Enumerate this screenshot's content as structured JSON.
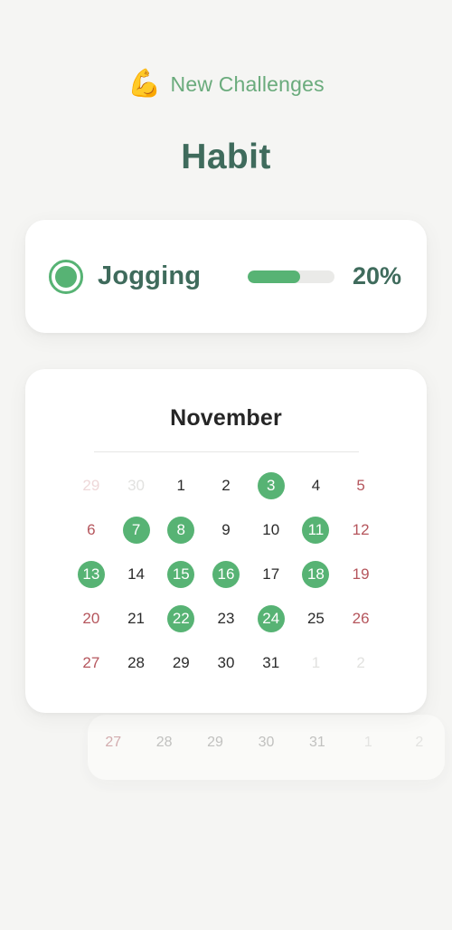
{
  "header": {
    "emoji": "💪",
    "emoji_name": "flexed-biceps-emoji",
    "title": "New Challenges",
    "page_title": "Habit"
  },
  "colors": {
    "background": "#f5f5f3",
    "card": "#ffffff",
    "accent_green": "#57b374",
    "sage_green": "#6aab7c",
    "dark_green": "#3f6b5c",
    "weekend_red": "#b5555c",
    "track_gray": "#eaeae8"
  },
  "habit": {
    "name": "Jogging",
    "percent_label": "20%",
    "percent_value": 20,
    "progress_fill_ratio": 60,
    "status_icon": "radio-selected-icon"
  },
  "calendar": {
    "month": "November",
    "weeks": [
      [
        {
          "label": "29",
          "state": "out-red"
        },
        {
          "label": "30",
          "state": "out-gray"
        },
        {
          "label": "1",
          "state": "normal"
        },
        {
          "label": "2",
          "state": "normal"
        },
        {
          "label": "3",
          "state": "done"
        },
        {
          "label": "4",
          "state": "normal"
        },
        {
          "label": "5",
          "state": "red"
        }
      ],
      [
        {
          "label": "6",
          "state": "red"
        },
        {
          "label": "7",
          "state": "done"
        },
        {
          "label": "8",
          "state": "done"
        },
        {
          "label": "9",
          "state": "normal"
        },
        {
          "label": "10",
          "state": "normal"
        },
        {
          "label": "11",
          "state": "done"
        },
        {
          "label": "12",
          "state": "red"
        }
      ],
      [
        {
          "label": "13",
          "state": "done"
        },
        {
          "label": "14",
          "state": "normal"
        },
        {
          "label": "15",
          "state": "done"
        },
        {
          "label": "16",
          "state": "done"
        },
        {
          "label": "17",
          "state": "normal"
        },
        {
          "label": "18",
          "state": "done"
        },
        {
          "label": "19",
          "state": "red"
        }
      ],
      [
        {
          "label": "20",
          "state": "red"
        },
        {
          "label": "21",
          "state": "normal"
        },
        {
          "label": "22",
          "state": "done"
        },
        {
          "label": "23",
          "state": "normal"
        },
        {
          "label": "24",
          "state": "done"
        },
        {
          "label": "25",
          "state": "normal"
        },
        {
          "label": "26",
          "state": "red"
        }
      ],
      [
        {
          "label": "27",
          "state": "red"
        },
        {
          "label": "28",
          "state": "normal"
        },
        {
          "label": "29",
          "state": "normal"
        },
        {
          "label": "30",
          "state": "normal"
        },
        {
          "label": "31",
          "state": "normal"
        },
        {
          "label": "1",
          "state": "out-gray"
        },
        {
          "label": "2",
          "state": "out-gray"
        }
      ]
    ]
  },
  "ghost_calendar": {
    "row": [
      {
        "label": "27",
        "state": "red"
      },
      {
        "label": "28",
        "state": "normal"
      },
      {
        "label": "29",
        "state": "normal"
      },
      {
        "label": "30",
        "state": "normal"
      },
      {
        "label": "31",
        "state": "normal"
      },
      {
        "label": "1",
        "state": "mute"
      },
      {
        "label": "2",
        "state": "mute"
      }
    ]
  }
}
